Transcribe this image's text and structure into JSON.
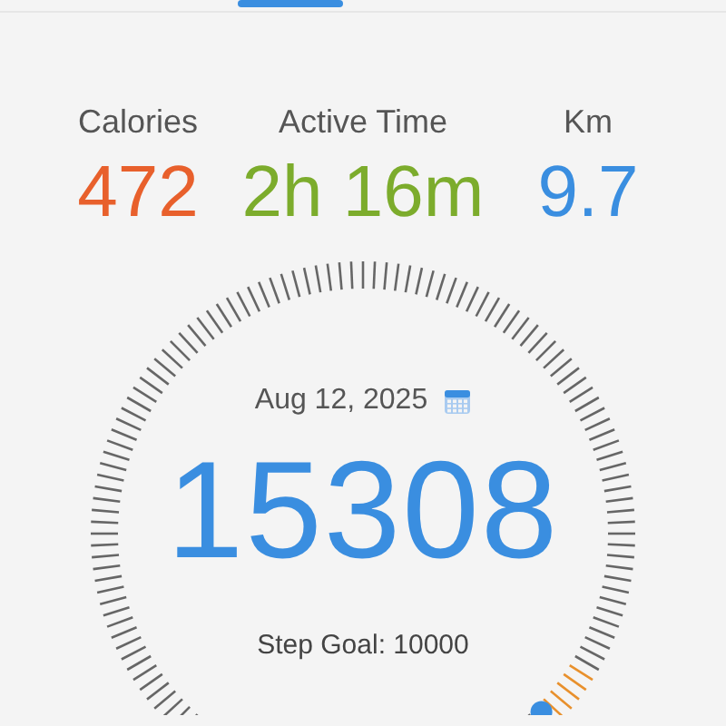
{
  "tabs": {
    "selected_indicator": true
  },
  "stats": [
    {
      "label": "Calories",
      "value": "472",
      "color": "#e8602c"
    },
    {
      "label": "Active Time",
      "value": "2h 16m",
      "color": "#7cac2c"
    },
    {
      "label": "Km",
      "value": "9.7",
      "color": "#3a8ee0"
    }
  ],
  "dial": {
    "date": "Aug 12, 2025",
    "steps": "15308",
    "goal": "Step Goal: 10000"
  }
}
